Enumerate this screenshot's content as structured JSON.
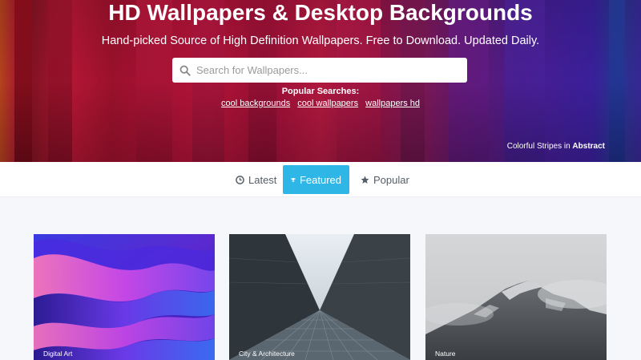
{
  "hero": {
    "title": "HD Wallpapers & Desktop Backgrounds",
    "subtitle": "Hand-picked Source of High Definition Wallpapers. Free to Download. Updated Daily.",
    "search_placeholder": "Search for Wallpapers...",
    "popular_label": "Popular Searches:",
    "popular_links": [
      "cool backgrounds",
      "cool wallpapers",
      "wallpapers hd"
    ],
    "credit_prefix": "Colorful Stripes in",
    "credit_category": "Abstract"
  },
  "tabs": [
    {
      "label": "Latest",
      "icon": "clock-icon",
      "active": false
    },
    {
      "label": "Featured",
      "icon": "trophy-icon",
      "active": true
    },
    {
      "label": "Popular",
      "icon": "star-icon",
      "active": false
    }
  ],
  "cards": [
    {
      "label": "Digital Art"
    },
    {
      "label": "City & Architecture"
    },
    {
      "label": "Nature"
    }
  ],
  "colors": {
    "tab_active": "#2eb7e6",
    "page_background": "#f5f7fa"
  }
}
